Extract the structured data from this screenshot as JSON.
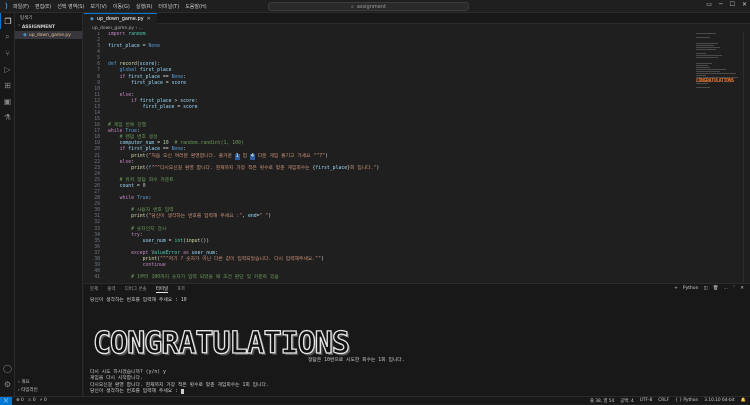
{
  "titlebar": {
    "menu": [
      "파일(F)",
      "편집(E)",
      "선택 영역(S)",
      "보기(V)",
      "이동(G)",
      "실행(R)",
      "터미널(T)",
      "도움말(H)"
    ],
    "search": "assignment",
    "nav_back": "←",
    "nav_fwd": "→"
  },
  "sidebar": {
    "title": "탐색기",
    "section": "ASSIGNMENT",
    "file": "up_down_game.py",
    "bottom": [
      "개요",
      "타임라인"
    ]
  },
  "editor": {
    "tab": "up_down_game.py",
    "breadcrumb": "up_down_game.py › ...",
    "minimap_banner": "CONGRATULATIONS"
  },
  "code_lines": [
    {
      "n": "1",
      "t": [
        [
          "kw",
          "import"
        ],
        [
          "op",
          " "
        ],
        [
          "cls",
          "random"
        ]
      ]
    },
    {
      "n": "2",
      "t": []
    },
    {
      "n": "3",
      "t": [
        [
          "var",
          "first_place"
        ],
        [
          "op",
          " = "
        ],
        [
          "kw2",
          "None"
        ]
      ]
    },
    {
      "n": "4",
      "t": []
    },
    {
      "n": "5",
      "t": []
    },
    {
      "n": "6",
      "t": [
        [
          "kw2",
          "def"
        ],
        [
          "op",
          " "
        ],
        [
          "fn",
          "record"
        ],
        [
          "op",
          "("
        ],
        [
          "var",
          "score"
        ],
        [
          "op",
          "):"
        ]
      ]
    },
    {
      "n": "7",
      "t": [
        [
          "op",
          "    "
        ],
        [
          "kw2",
          "global"
        ],
        [
          "op",
          " "
        ],
        [
          "var",
          "first_place"
        ]
      ]
    },
    {
      "n": "8",
      "t": [
        [
          "op",
          "    "
        ],
        [
          "kw",
          "if"
        ],
        [
          "op",
          " "
        ],
        [
          "var",
          "first_place"
        ],
        [
          "op",
          " == "
        ],
        [
          "kw2",
          "None"
        ],
        [
          "op",
          ":"
        ]
      ]
    },
    {
      "n": "9",
      "t": [
        [
          "op",
          "        "
        ],
        [
          "var",
          "first_place"
        ],
        [
          "op",
          " = "
        ],
        [
          "var",
          "score"
        ]
      ]
    },
    {
      "n": "10",
      "t": []
    },
    {
      "n": "11",
      "t": [
        [
          "op",
          "    "
        ],
        [
          "kw",
          "else"
        ],
        [
          "op",
          ":"
        ]
      ]
    },
    {
      "n": "12",
      "t": [
        [
          "op",
          "        "
        ],
        [
          "kw",
          "if"
        ],
        [
          "op",
          " "
        ],
        [
          "var",
          "first_place"
        ],
        [
          "op",
          " > "
        ],
        [
          "var",
          "score"
        ],
        [
          "op",
          ":"
        ]
      ]
    },
    {
      "n": "13",
      "t": [
        [
          "op",
          "            "
        ],
        [
          "var",
          "first_place"
        ],
        [
          "op",
          " = "
        ],
        [
          "var",
          "score"
        ]
      ]
    },
    {
      "n": "14",
      "t": []
    },
    {
      "n": "15",
      "t": []
    },
    {
      "n": "16",
      "t": [
        [
          "com",
          "# 게임 반복 진행"
        ]
      ]
    },
    {
      "n": "17",
      "t": [
        [
          "kw",
          "while"
        ],
        [
          "op",
          " "
        ],
        [
          "kw2",
          "True"
        ],
        [
          "op",
          ":"
        ]
      ]
    },
    {
      "n": "18",
      "t": [
        [
          "op",
          "    "
        ],
        [
          "com",
          "# 랜덤 번호 생성"
        ]
      ]
    },
    {
      "n": "19",
      "t": [
        [
          "op",
          "    "
        ],
        [
          "var",
          "computer_num"
        ],
        [
          "op",
          " = "
        ],
        [
          "num",
          "10"
        ],
        [
          "op",
          "  "
        ],
        [
          "com",
          "# random.randint(1, 100)"
        ]
      ]
    },
    {
      "n": "20",
      "t": [
        [
          "op",
          "    "
        ],
        [
          "kw",
          "if"
        ],
        [
          "op",
          " "
        ],
        [
          "var",
          "first_place"
        ],
        [
          "op",
          " == "
        ],
        [
          "kw2",
          "None"
        ],
        [
          "op",
          ":"
        ]
      ]
    },
    {
      "n": "21",
      "t": [
        [
          "op",
          "        "
        ],
        [
          "fn",
          "print"
        ],
        [
          "op",
          "("
        ],
        [
          "str",
          "\"처음 오신 여러분 환영합니다. 즐거운 "
        ],
        [
          "hl",
          "1"
        ],
        [
          "str",
          " 업 "
        ],
        [
          "hl",
          "4"
        ],
        [
          "str",
          " 다운 게임 즐기고 가세요 ^^7\""
        ],
        [
          "op",
          ")"
        ]
      ]
    },
    {
      "n": "22",
      "t": [
        [
          "op",
          "    "
        ],
        [
          "kw",
          "else"
        ],
        [
          "op",
          ":"
        ]
      ]
    },
    {
      "n": "23",
      "t": [
        [
          "op",
          "        "
        ],
        [
          "fn",
          "print"
        ],
        [
          "op",
          "("
        ],
        [
          "kw2",
          "f"
        ],
        [
          "str",
          "\"^^다시오신걸 환영 합니다. 현재까지 가장 적은 횟수로 맞춘 게임회수는 "
        ],
        [
          "op",
          "{"
        ],
        [
          "var",
          "first_place"
        ],
        [
          "op",
          "}"
        ],
        [
          "str",
          "회 입니다.\""
        ],
        [
          "op",
          ")"
        ]
      ]
    },
    {
      "n": "24",
      "t": []
    },
    {
      "n": "25",
      "t": [
        [
          "op",
          "    "
        ],
        [
          "com",
          "# 유저 정답 회수 카운트"
        ]
      ]
    },
    {
      "n": "26",
      "t": [
        [
          "op",
          "    "
        ],
        [
          "var",
          "count"
        ],
        [
          "op",
          " = "
        ],
        [
          "num",
          "0"
        ]
      ]
    },
    {
      "n": "27",
      "t": []
    },
    {
      "n": "28",
      "t": [
        [
          "op",
          "    "
        ],
        [
          "kw",
          "while"
        ],
        [
          "op",
          " "
        ],
        [
          "kw2",
          "True"
        ],
        [
          "op",
          ":"
        ]
      ]
    },
    {
      "n": "29",
      "t": []
    },
    {
      "n": "30",
      "t": [
        [
          "op",
          "        "
        ],
        [
          "com",
          "# 사용자 번호 입력"
        ]
      ]
    },
    {
      "n": "31",
      "t": [
        [
          "op",
          "        "
        ],
        [
          "fn",
          "print"
        ],
        [
          "op",
          "("
        ],
        [
          "str",
          "\"당신이 생각하는 번호를 입력해 주세요 :\""
        ],
        [
          "op",
          ", "
        ],
        [
          "var",
          "end"
        ],
        [
          "op",
          "="
        ],
        [
          "str",
          "\" \""
        ],
        [
          "op",
          ")"
        ]
      ]
    },
    {
      "n": "32",
      "t": []
    },
    {
      "n": "33",
      "t": [
        [
          "op",
          "        "
        ],
        [
          "com",
          "# 숫자인지 검사"
        ]
      ]
    },
    {
      "n": "34",
      "t": [
        [
          "op",
          "        "
        ],
        [
          "kw",
          "try"
        ],
        [
          "op",
          ":"
        ]
      ]
    },
    {
      "n": "35",
      "t": [
        [
          "op",
          "            "
        ],
        [
          "var",
          "user_num"
        ],
        [
          "op",
          " = "
        ],
        [
          "cls",
          "int"
        ],
        [
          "op",
          "("
        ],
        [
          "fn",
          "input"
        ],
        [
          "op",
          "())"
        ]
      ]
    },
    {
      "n": "36",
      "t": []
    },
    {
      "n": "37",
      "t": [
        [
          "op",
          "        "
        ],
        [
          "kw",
          "except"
        ],
        [
          "op",
          " "
        ],
        [
          "cls",
          "ValueError"
        ],
        [
          "op",
          " "
        ],
        [
          "kw",
          "as"
        ],
        [
          "op",
          " "
        ],
        [
          "var",
          "user_num"
        ],
        [
          "op",
          ":"
        ]
      ]
    },
    {
      "n": "38",
      "t": [
        [
          "op",
          "            "
        ],
        [
          "fn",
          "print"
        ],
        [
          "op",
          "("
        ],
        [
          "str",
          "\"^^저기 ? 숫자가 아닌 다른 값이 입력되었습니다. 다시 입력해주세요.^\""
        ],
        [
          "op",
          ")"
        ]
      ]
    },
    {
      "n": "39",
      "t": [
        [
          "op",
          "            "
        ],
        [
          "kw",
          "continue"
        ]
      ]
    },
    {
      "n": "40",
      "t": []
    },
    {
      "n": "41",
      "t": [
        [
          "op",
          "        "
        ],
        [
          "com",
          "# 1부터 100까지 숫자가 입력 되었을 때 조건 판단 및 카운트 있음"
        ]
      ]
    }
  ],
  "panel": {
    "tabs": [
      "문제",
      "출력",
      "디버그 콘솔",
      "터미널",
      "포트"
    ],
    "active_tab": "터미널",
    "shell": "Python",
    "terminal": {
      "line1": "당신이 생각하는 번호를 입력해 주세요 : 10",
      "banner": "CONGRATULATIONS",
      "result": "정답은 10번으로 시도한 회수는 1회 입니다.",
      "retry": "다시 시도 하시겠습니까? (y/n) y",
      "restart": "게임을 다시 시작합니다.",
      "welcome": "다시오신걸 환영 합니다. 현재까지 가장 적은 횟수로 맞춘 게임회수는 1회 입니다.",
      "prompt": "당신이 생각하는 번호를 입력해 주세요 : "
    }
  },
  "status": {
    "errors": "⊗ 0",
    "warnings": "⚠ 0",
    "ports": "⚡ 0",
    "position": "줄 38, 열 54",
    "spaces": "공백: 4",
    "encoding": "UTF-8",
    "eol": "CRLF",
    "language": "{ } Python",
    "interpreter": "3.10.10 64-bit"
  }
}
